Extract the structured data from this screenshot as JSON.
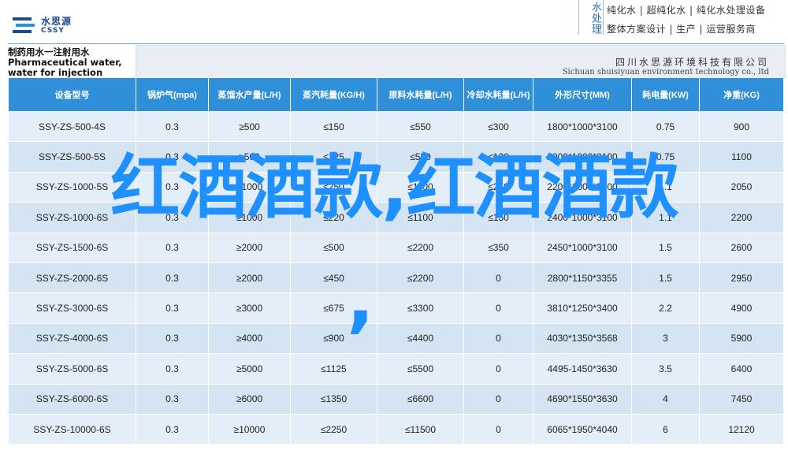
{
  "header": {
    "logo_name": "水思源",
    "logo_sub": "CSSY",
    "brand_vertical": "水处理",
    "slogan_line1": "纯化水 | 超纯化水 | 纯化水处理设备",
    "slogan_line2": "整体方案设计 | 生产 | 运营服务商",
    "product_title": "制药用水一注射用水 Pharmaceutical water, water for injection",
    "company_cn": "四川水思源环境科技有限公司",
    "company_en": "Sichuan shuisiyuan environment technology co., ltd",
    "accent_color": "#2f8fd8"
  },
  "table": {
    "columns": [
      "设备型号",
      "锅炉气(mpa)",
      "蒸馏水产量(L/H)",
      "蒸汽耗量(KG/H)",
      "原料水耗量(L/H)",
      "冷却水耗量(L/H)",
      "外形尺寸(MM)",
      "耗电量(KW)",
      "净重(KG)"
    ],
    "rows": [
      [
        "SSY-ZS-500-4S",
        "0.3",
        "≥500",
        "≤150",
        "≤550",
        "≤300",
        "1800*1000*3100",
        "0.75",
        "900"
      ],
      [
        "SSY-ZS-500-5S",
        "0.3",
        "≥500",
        "≤125",
        "≤550",
        "≤120",
        "2000*1000*3100",
        "0.75",
        "1100"
      ],
      [
        "SSY-ZS-1000-5S",
        "0.3",
        "≥1000",
        "≤250",
        "≤1100",
        "≤250",
        "2200*1000*3100",
        "1.1",
        "2050"
      ],
      [
        "SSY-ZS-1000-6S",
        "0.3",
        "≥1000",
        "≤220",
        "≤1100",
        "≤150",
        "2400*1000*3100",
        "1.1",
        "2200"
      ],
      [
        "SSY-ZS-1500-6S",
        "0.3",
        "≥2000",
        "≤500",
        "≤2200",
        "≤350",
        "2450*1000*3100",
        "1.5",
        "2600"
      ],
      [
        "SSY-ZS-2000-6S",
        "0.3",
        "≥2000",
        "≤450",
        "≤2200",
        "0",
        "2800*1150*3355",
        "1.5",
        "2950"
      ],
      [
        "SSY-ZS-3000-6S",
        "0.3",
        "≥3000",
        "≤675",
        "≤3300",
        "0",
        "3810*1250*3400",
        "2.2",
        "4900"
      ],
      [
        "SSY-ZS-4000-6S",
        "0.3",
        "≥4000",
        "≤900",
        "≤4400",
        "0",
        "4030*1350*3568",
        "3",
        "5900"
      ],
      [
        "SSY-ZS-5000-6S",
        "0.3",
        "≥5000",
        "≤1125",
        "≤5500",
        "0",
        "4495-1450*3630",
        "3.5",
        "6400"
      ],
      [
        "SSY-ZS-6000-6S",
        "0.3",
        "≥6000",
        "≤1350",
        "≤6600",
        "0",
        "4690*1550*3630",
        "4",
        "7450"
      ],
      [
        "SSY-ZS-10000-6S",
        "0.3",
        "≥10000",
        "≤2250",
        "≤11500",
        "0",
        "6065*1950*4040",
        "6",
        "12120"
      ]
    ]
  },
  "overlay": {
    "text": "红酒酒款,红酒酒款",
    "comma": ",",
    "color": "#1e90ff"
  }
}
